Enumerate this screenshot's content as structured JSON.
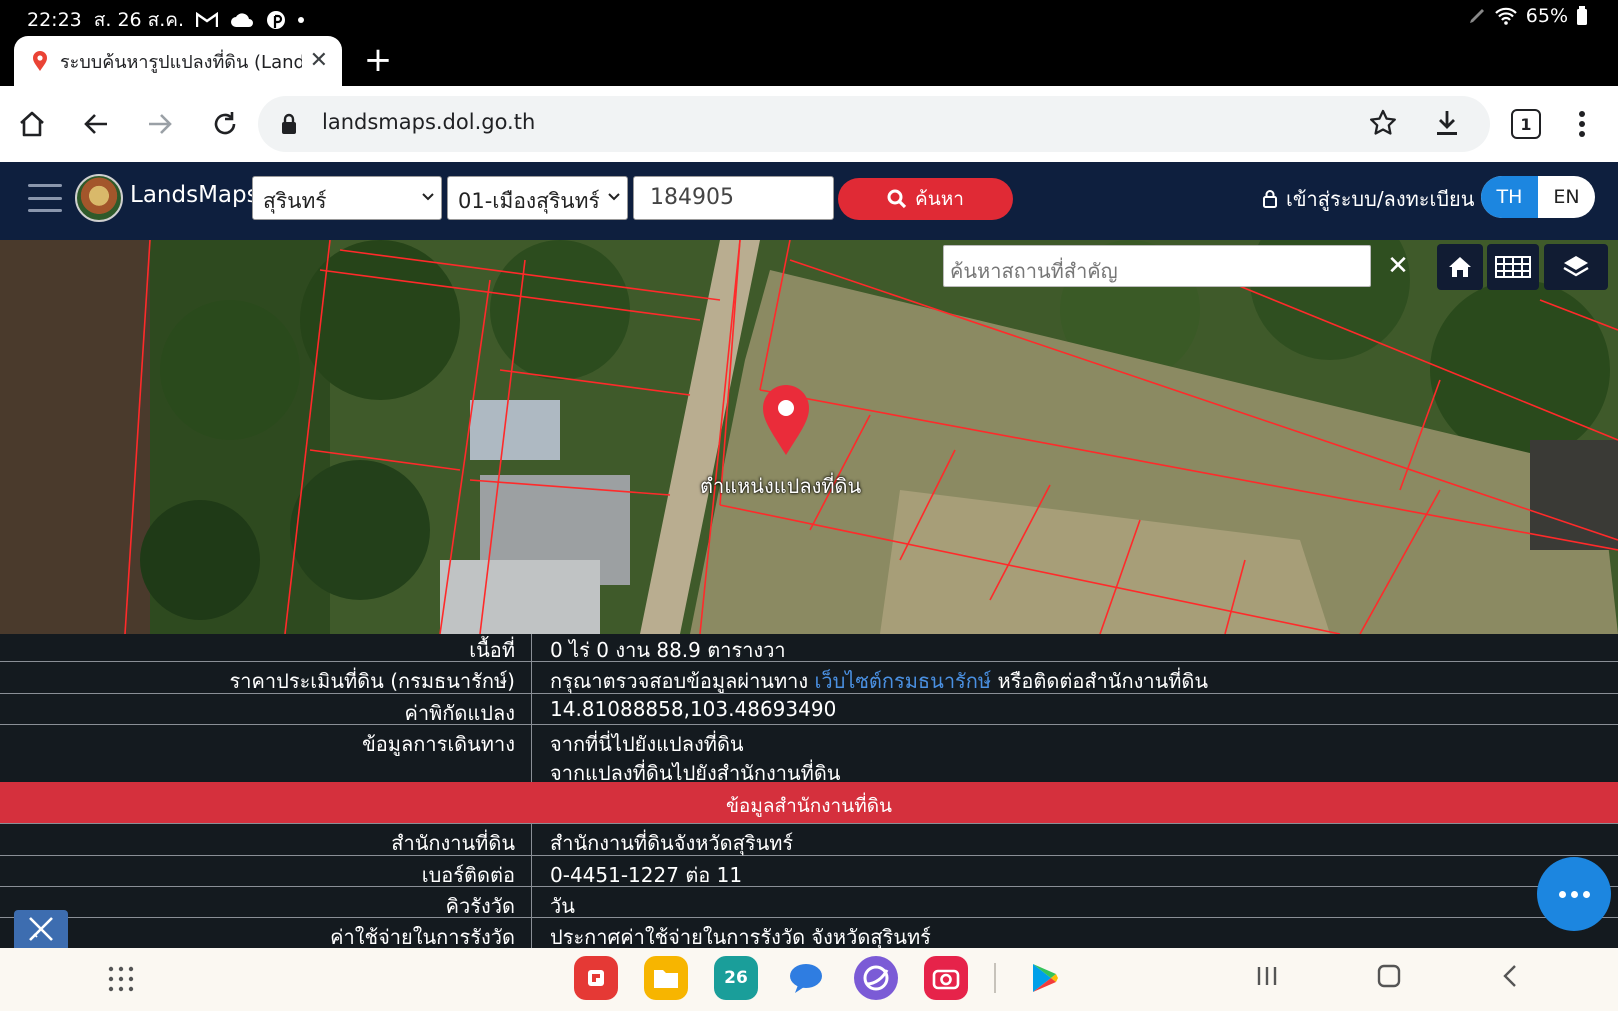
{
  "status_bar": {
    "time": "22:23",
    "date": "ส. 26 ส.ค.",
    "battery": "65%",
    "notification_icons": [
      "gmail-icon",
      "cloud-icon",
      "pinterest-icon"
    ]
  },
  "browser": {
    "tab_title": "ระบบค้นหารูปแปลงที่ดิน (Land",
    "url": "landsmaps.dol.go.th",
    "tab_count": "1"
  },
  "header": {
    "brand": "LandsMaps",
    "province": "สุรินทร์",
    "district": "01-เมืองสุรินทร์",
    "parcel_number": "184905",
    "search_label": "ค้นหา",
    "login_label": "เข้าสู่ระบบ/ลงทะเบียน",
    "lang_th": "TH",
    "lang_en": "EN",
    "colors": {
      "header_bg": "#0e1f3e",
      "search_btn": "#e02a35",
      "lang_active": "#1c86e0"
    }
  },
  "map": {
    "place_search_placeholder": "ค้นหาสถานที่สำคัญ",
    "marker_label": "ตำแหน่งแปลงที่ดิน",
    "controls": [
      "home-icon",
      "grid-icon",
      "layers-icon"
    ]
  },
  "info": {
    "rows": [
      {
        "label": "เนื้อที่",
        "value": "0 ไร่ 0 งาน 88.9 ตารางวา"
      },
      {
        "label": "ราคาประเมินที่ดิน (กรมธนารักษ์)",
        "value_pre": "กรุณาตรวจสอบข้อมูลผ่านทาง",
        "value_link": "เว็บไซต์กรมธนารักษ์",
        "value_post": "หรือติดต่อสำนักงานที่ดิน"
      },
      {
        "label": "ค่าพิกัดแปลง",
        "value": "14.81088858,103.48693490"
      },
      {
        "label": "ข้อมูลการเดินทาง",
        "link1": "จากที่นี่ไปยังแปลงที่ดิน",
        "link2": "จากแปลงที่ดินไปยังสำนักงานที่ดิน"
      }
    ],
    "office_section_title": "ข้อมูลสำนักงานที่ดิน",
    "office_rows": [
      {
        "label": "สำนักงานที่ดิน",
        "value": "สำนักงานที่ดินจังหวัดสุรินทร์"
      },
      {
        "label": "เบอร์ติดต่อ",
        "value": "0-4451-1227 ต่อ 11"
      },
      {
        "label": "คิวรังวัด",
        "value": "วัน"
      },
      {
        "label": "ค่าใช้จ่ายในการรังวัด",
        "value": "ประกาศค่าใช้จ่ายในการรังวัด จังหวัดสุรินทร์"
      }
    ],
    "section_color": "#d5303d"
  },
  "taskbar": {
    "calendar_day": "26",
    "apps": [
      "flipboard-icon",
      "files-icon",
      "calendar-icon",
      "messages-icon",
      "internet-icon",
      "camera-icon",
      "play-store-icon"
    ]
  }
}
